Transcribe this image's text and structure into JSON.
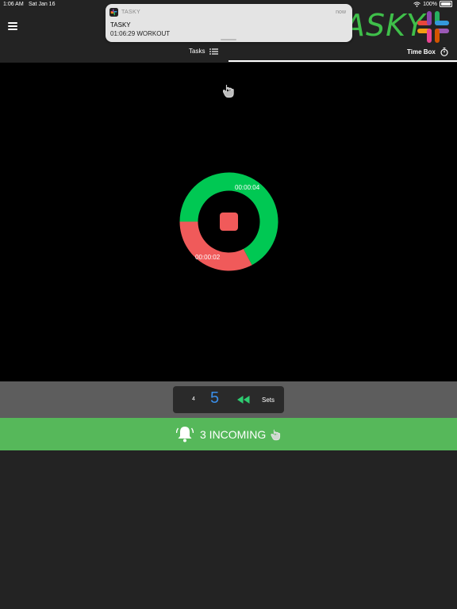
{
  "status_bar": {
    "time": "1:06 AM",
    "date": "Sat Jan 16",
    "battery": "100%"
  },
  "header": {
    "logo_text": "ASKY",
    "tabs": {
      "tasks": "Tasks",
      "timebox": "Time Box"
    }
  },
  "notification": {
    "app_name": "TASKY",
    "time": "now",
    "title": "TASKY",
    "body": "01:06:29  WORKOUT"
  },
  "timer": {
    "elapsed_green": "00:00:04",
    "elapsed_red": "00:00:02",
    "green_fraction": 0.62,
    "red_fraction": 0.38
  },
  "sets": {
    "previous": "4",
    "current": "5",
    "label": "Sets"
  },
  "incoming": {
    "text": "3 INCOMING"
  },
  "colors": {
    "green": "#00c853",
    "red": "#f05a5a",
    "accent_blue": "#3a8ee8",
    "incoming_green": "#56b85a",
    "logo_green": "#3fbf4a"
  }
}
